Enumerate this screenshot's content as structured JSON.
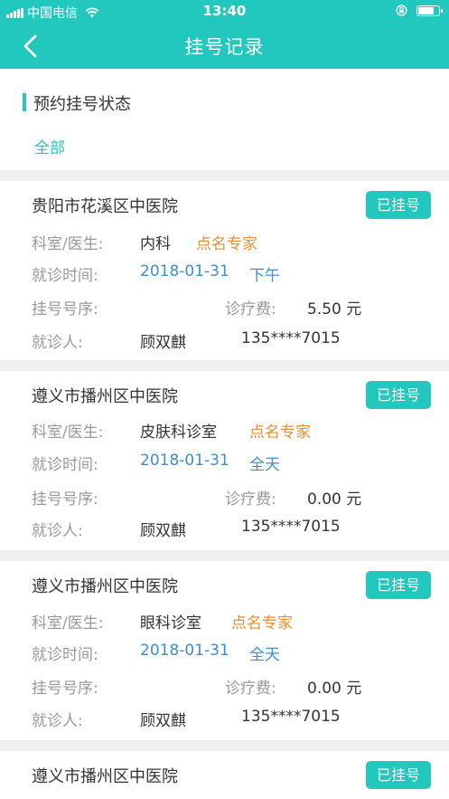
{
  "status_bar": {
    "carrier": "中国电信",
    "time": "13:40"
  },
  "header": {
    "title": "挂号记录"
  },
  "filter": {
    "title": "预约挂号状态",
    "option": "全部"
  },
  "labels": {
    "dept": "科室/医生:",
    "time": "就诊时间:",
    "seq": "挂号号序:",
    "fee": "诊疗费:",
    "patient": "就诊人:"
  },
  "records": [
    {
      "hospital": "贵阳市花溪区中医院",
      "status": "已挂号",
      "dept": "内科",
      "doctor": "点名专家",
      "date": "2018-01-31",
      "period": "下午",
      "fee": "5.50 元",
      "patient": "顾双麒",
      "phone": "135****7015"
    },
    {
      "hospital": "遵义市播州区中医院",
      "status": "已挂号",
      "dept": "皮肤科诊室",
      "doctor": "点名专家",
      "date": "2018-01-31",
      "period": "全天",
      "fee": "0.00 元",
      "patient": "顾双麒",
      "phone": "135****7015"
    },
    {
      "hospital": "遵义市播州区中医院",
      "status": "已挂号",
      "dept": "眼科诊室",
      "doctor": "点名专家",
      "date": "2018-01-31",
      "period": "全天",
      "fee": "0.00 元",
      "patient": "顾双麒",
      "phone": "135****7015"
    },
    {
      "hospital": "遵义市播州区中医院",
      "status": "已挂号"
    }
  ]
}
